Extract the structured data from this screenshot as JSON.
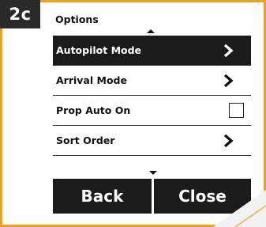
{
  "step_tag": "2c",
  "screen": {
    "title": "Options",
    "menu_items": [
      {
        "label": "Autopilot Mode",
        "selected": true,
        "control": "chevron"
      },
      {
        "label": "Arrival Mode",
        "selected": false,
        "control": "chevron"
      },
      {
        "label": "Prop Auto On",
        "selected": false,
        "control": "checkbox",
        "checked": false
      },
      {
        "label": "Sort Order",
        "selected": false,
        "control": "chevron"
      }
    ],
    "buttons": {
      "back_label": "Back",
      "close_label": "Close"
    }
  },
  "colors": {
    "frame_border": "#f0a020",
    "selected_bg": "#1b1b1b",
    "button_bg": "#1b1b1b",
    "tag_bg": "#2a2a2a"
  }
}
